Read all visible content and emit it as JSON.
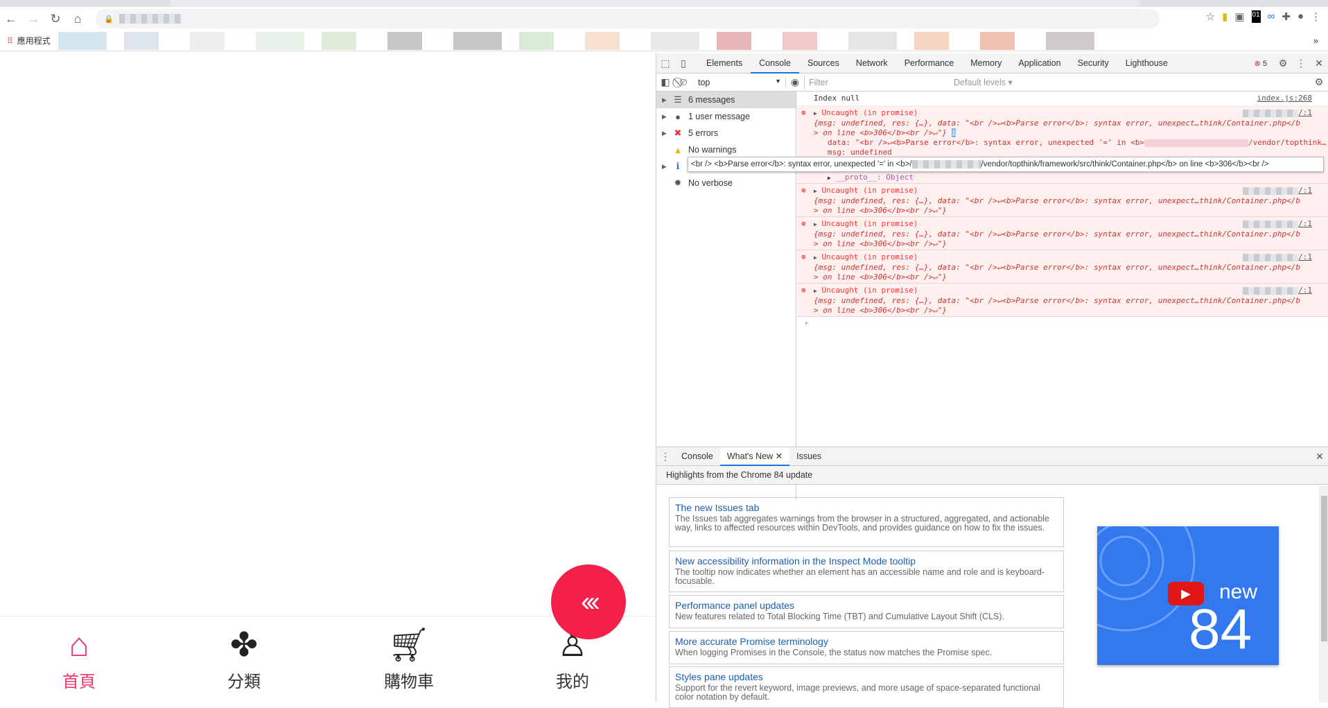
{
  "browser": {
    "bookmarks_label": "應用程式"
  },
  "devtools": {
    "tabs": [
      "Elements",
      "Console",
      "Sources",
      "Network",
      "Performance",
      "Memory",
      "Application",
      "Security",
      "Lighthouse"
    ],
    "active_tab": "Console",
    "error_count": "5",
    "context": "top",
    "filter_placeholder": "Filter",
    "levels": "Default levels ▾",
    "sidebar": [
      {
        "label": "6 messages",
        "icon": "list-icon"
      },
      {
        "label": "1 user message",
        "icon": "user-icon"
      },
      {
        "label": "5 errors",
        "icon": "error-icon"
      },
      {
        "label": "No warnings",
        "icon": "warning-icon"
      },
      {
        "label": "",
        "icon": "info-icon"
      },
      {
        "label": "No verbose",
        "icon": "bug-icon"
      }
    ],
    "log": {
      "text": "Index null",
      "source": "index.js:268"
    },
    "errors": [
      {
        "title": "Uncaught (in promise)",
        "source": "/:1",
        "line1": "{msg: undefined, res: {…}, data: \"<br />↵<b>Parse error</b>:  syntax error, unexpect…think/Container.php</b",
        "line2": "> on line <b>306</b><br />↵\"}",
        "expanded": true,
        "data_line": "data: \"<br />↵<b>Parse error</b>:  syntax error, unexpected '=' in <b>",
        "data_tail": "/vendor/topthink…",
        "msg_line": "msg: undefined",
        "proto": "__proto__: Object"
      },
      {
        "title": "Uncaught (in promise)",
        "source": "/:1",
        "line1": "{msg: undefined, res: {…}, data: \"<br />↵<b>Parse error</b>:  syntax error, unexpect…think/Container.php</b",
        "line2": "> on line <b>306</b><br />↵\"}"
      },
      {
        "title": "Uncaught (in promise)",
        "source": "/:1",
        "line1": "{msg: undefined, res: {…}, data: \"<br />↵<b>Parse error</b>:  syntax error, unexpect…think/Container.php</b",
        "line2": "> on line <b>306</b><br />↵\"}"
      },
      {
        "title": "Uncaught (in promise)",
        "source": "/:1",
        "line1": "{msg: undefined, res: {…}, data: \"<br />↵<b>Parse error</b>:  syntax error, unexpect…think/Container.php</b",
        "line2": "> on line <b>306</b><br />↵\"}"
      },
      {
        "title": "Uncaught (in promise)",
        "source": "/:1",
        "line1": "{msg: undefined, res: {…}, data: \"<br />↵<b>Parse error</b>:  syntax error, unexpect…think/Container.php</b",
        "line2": "> on line <b>306</b><br />↵\"}"
      }
    ],
    "tooltip_a": "<br /> <b>Parse error</b>: syntax error, unexpected '=' in <b>/",
    "tooltip_b": "/vendor/topthink/framework/src/think/Container.php</b> on line <b>306</b><br />",
    "prompt": "›",
    "drawer": {
      "tabs": [
        "Console",
        "What's New",
        "Issues"
      ],
      "active": "What's New",
      "highlights": "Highlights from the Chrome 84 update",
      "cards": [
        {
          "title": "The new Issues tab",
          "desc": "The Issues tab aggregates warnings from the browser in a structured, aggregated, and actionable way, links to affected resources within DevTools, and provides guidance on how to fix the issues."
        },
        {
          "title": "New accessibility information in the Inspect Mode tooltip",
          "desc": "The tooltip now indicates whether an element has an accessible name and role and is keyboard-focusable."
        },
        {
          "title": "Performance panel updates",
          "desc": "New features related to Total Blocking Time (TBT) and Cumulative Layout Shift (CLS)."
        },
        {
          "title": "More accurate Promise terminology",
          "desc": "When logging Promises in the Console, the status now matches the Promise spec."
        },
        {
          "title": "Styles pane updates",
          "desc": "Support for the revert keyword, image previews, and more usage of space-separated functional color notation by default."
        }
      ],
      "video": {
        "new": "new",
        "version": "84"
      }
    }
  },
  "app": {
    "nav": [
      {
        "label": "首頁",
        "icon": "home-icon",
        "active": true
      },
      {
        "label": "分類",
        "icon": "category-icon"
      },
      {
        "label": "購物車",
        "icon": "cart-icon"
      },
      {
        "label": "我的",
        "icon": "user-icon"
      }
    ],
    "fab_icon": "chevrons-left-icon",
    "accent": "#f0386b",
    "fab_color": "#f2204a"
  }
}
